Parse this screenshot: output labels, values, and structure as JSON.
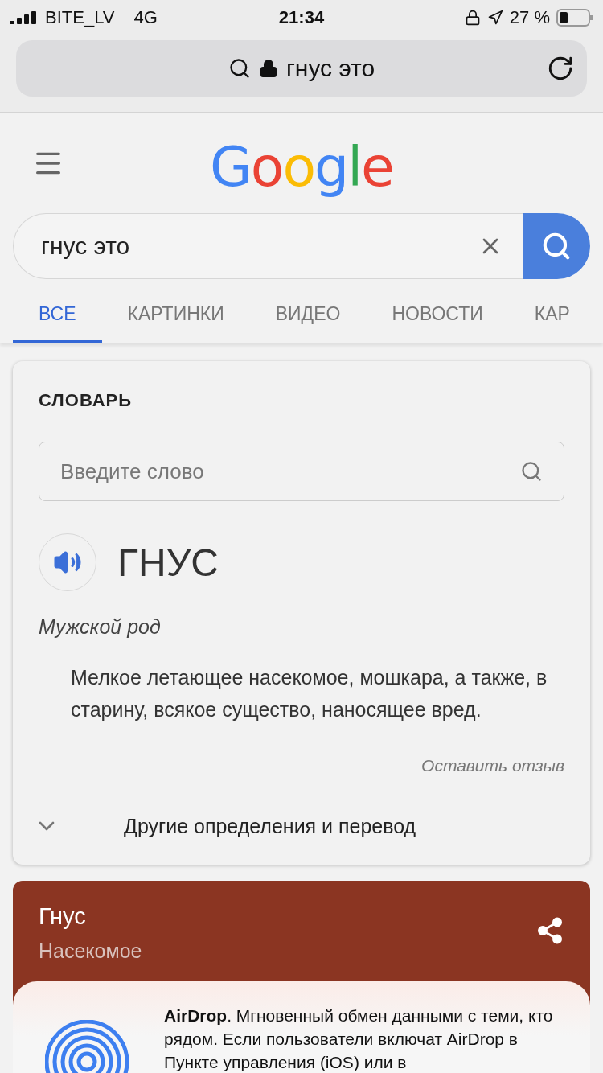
{
  "status_bar": {
    "carrier": "BITE_LV",
    "network": "4G",
    "time": "21:34",
    "battery": "27 %"
  },
  "address_bar": {
    "text": "гнус это"
  },
  "header": {
    "logo": "Google"
  },
  "search": {
    "value": "гнус это"
  },
  "tabs": [
    {
      "label": "ВСЕ",
      "selected": true
    },
    {
      "label": "КАРТИНКИ",
      "selected": false
    },
    {
      "label": "ВИДЕО",
      "selected": false
    },
    {
      "label": "НОВОСТИ",
      "selected": false
    },
    {
      "label": "КАР",
      "selected": false
    }
  ],
  "dictionary": {
    "title": "СЛОВАРЬ",
    "placeholder": "Введите слово",
    "word": "ГНУС",
    "gender": "Мужской род",
    "definition": "Мелкое летающее насекомое, мошкара, а также, в старину, всякое существо, наносящее вред.",
    "feedback": "Оставить отзыв",
    "more": "Другие определения и перевод"
  },
  "knowledge_card": {
    "title": "Гнус",
    "subtitle": "Насекомое"
  },
  "share_sheet": {
    "text": "**AirDrop**. Мгновенный обмен данными с теми, кто рядом. Если пользователи включат AirDrop в Пункте управления (iOS) или в"
  }
}
